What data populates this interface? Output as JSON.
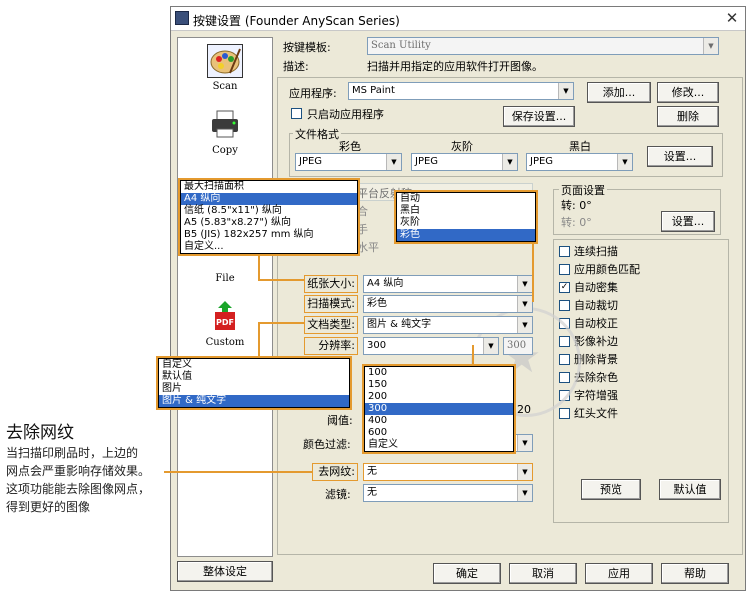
{
  "window": {
    "title": "按键设置 (Founder AnyScan Series)"
  },
  "nav": {
    "items": [
      {
        "label": "Scan",
        "icon": "palette-icon"
      },
      {
        "label": "Copy",
        "icon": "printer-icon"
      },
      {
        "label": "File",
        "icon": "folder-icon"
      },
      {
        "label": "Custom",
        "icon": "pdf-icon"
      }
    ]
  },
  "template": {
    "label": "按键模板:",
    "value": "Scan Utility"
  },
  "description": {
    "label": "描述:",
    "value": "扫描并用指定的应用软件打开图像。"
  },
  "app": {
    "label": "应用程序:",
    "value": "MS Paint",
    "add": "添加...",
    "modify": "修改...",
    "delete": "删除",
    "only_launch": "只启动应用程序",
    "save_settings": "保存设置..."
  },
  "file_format": {
    "label": "文件格式",
    "color_label": "彩色",
    "gray_label": "灰阶",
    "bw_label": "黑白",
    "color": "JPEG",
    "gray": "JPEG",
    "bw": "JPEG",
    "settings": "设置..."
  },
  "page_settings": {
    "label": "页面设置",
    "rot1": "转: 0°",
    "rot2": "转: 0°",
    "settings": "设置..."
  },
  "paper_popup": {
    "items": [
      "最大扫描面积",
      "A4 纵向",
      "信纸 (8.5\"x11\") 纵向",
      "A5 (5.83\"x8.27\") 纵向",
      "B5 (JIS) 182x257 mm 纵向",
      "自定义..."
    ],
    "selected": 1
  },
  "color_popup": {
    "items": [
      "自动",
      "黑白",
      "灰阶",
      "彩色"
    ],
    "selected": 3
  },
  "behind_partial": {
    "a": "平台反射稿",
    "b": "合",
    "c": "手",
    "d": "水平"
  },
  "form": {
    "paper_label": "纸张大小:",
    "paper": "A4 纵向",
    "mode_label": "扫描模式:",
    "mode": "彩色",
    "doctype_label": "文档类型:",
    "doctype": "图片 & 纯文字",
    "dpi_label": "分辨率:",
    "dpi": "300",
    "dpi2": "300",
    "threshold_label": "阈值:",
    "threshold_value": "20",
    "colorfilter_label": "颜色过滤:",
    "descreen_label": "去网纹:",
    "descreen": "无",
    "filter_label": "滤镜:",
    "filter": "无"
  },
  "doctype_popup": {
    "items": [
      "自定义",
      "默认值",
      "图片",
      "图片 & 纯文字"
    ],
    "selected": 3
  },
  "dpi_popup": {
    "items": [
      "100",
      "150",
      "200",
      "300",
      "400",
      "600",
      "自定义"
    ],
    "selected": 3
  },
  "options": [
    {
      "label": "连续扫描",
      "checked": false
    },
    {
      "label": "应用颜色匹配",
      "checked": false
    },
    {
      "label": "自动密集",
      "checked": true
    },
    {
      "label": "自动裁切",
      "checked": false
    },
    {
      "label": "自动校正",
      "checked": false
    },
    {
      "label": "影像补边",
      "checked": false
    },
    {
      "label": "删除背景",
      "checked": false
    },
    {
      "label": "去除杂色",
      "checked": false
    },
    {
      "label": "字符增强",
      "checked": false
    },
    {
      "label": "红头文件",
      "checked": false
    }
  ],
  "buttons": {
    "preview": "预览",
    "default": "默认值",
    "overall": "整体设定",
    "ok": "确定",
    "cancel": "取消",
    "apply": "应用",
    "help": "帮助"
  },
  "annotation": {
    "title": "去除网纹",
    "lines": [
      "当扫描印刷品时，上边的",
      "网点会严重影响存储效果。",
      "这项功能能去除图像网点，",
      "得到更好的图像"
    ]
  },
  "colors": {
    "accent": "#e49a2f",
    "selection": "#3169c6",
    "window": "#ece9d8"
  }
}
